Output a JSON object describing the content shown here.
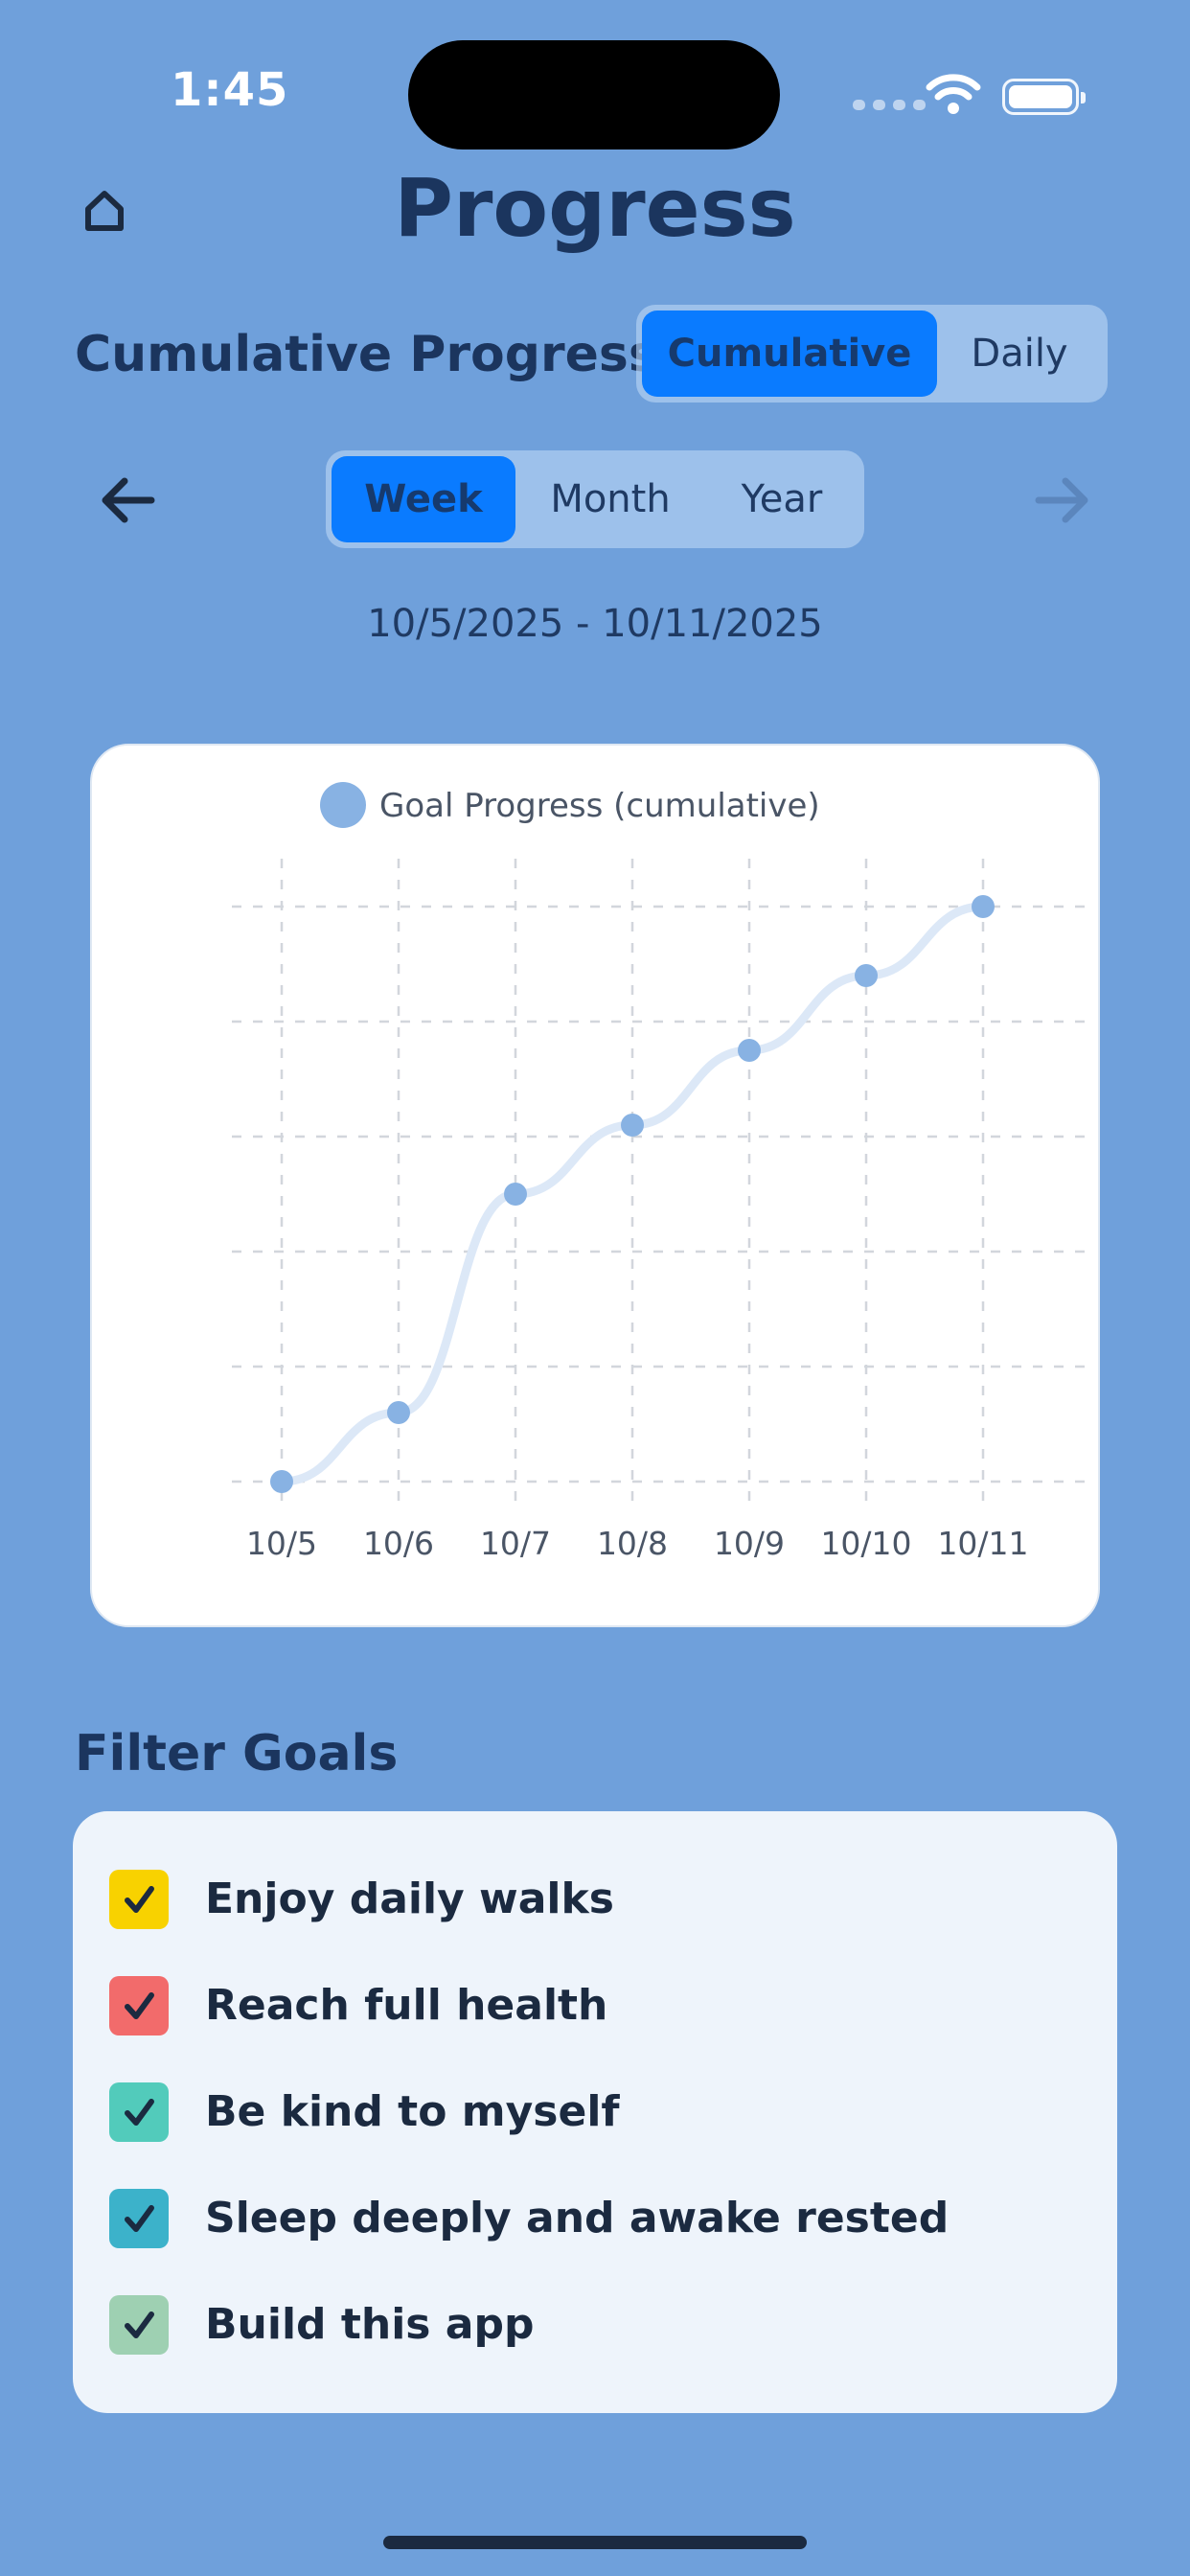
{
  "status": {
    "time": "1:45"
  },
  "header": {
    "title": "Progress",
    "home_icon": "home-icon"
  },
  "section": {
    "title": "Cumulative Progress"
  },
  "mode_toggle": {
    "options": [
      "Cumulative",
      "Daily"
    ],
    "selected": "Cumulative"
  },
  "range_toggle": {
    "options": [
      "Week",
      "Month",
      "Year"
    ],
    "selected": "Week"
  },
  "nav": {
    "prev_icon": "arrow-left-icon",
    "next_icon": "arrow-right-icon"
  },
  "date_range": "10/5/2025 - 10/11/2025",
  "colors": {
    "background": "#6fa0db",
    "accent": "#0a7bff",
    "series": "#88b2e3",
    "line": "#dce8f7"
  },
  "chart_data": {
    "type": "line",
    "legend": [
      "Goal Progress (cumulative)"
    ],
    "categories": [
      "10/5",
      "10/6",
      "10/7",
      "10/8",
      "10/9",
      "10/10",
      "10/11"
    ],
    "series": [
      {
        "name": "Goal Progress (cumulative)",
        "values": [
          0,
          0.6,
          2.5,
          3.1,
          3.75,
          4.4,
          5.0
        ]
      }
    ],
    "ylim": [
      0,
      5
    ],
    "grid": true,
    "legend_position": "top-center"
  },
  "filter": {
    "title": "Filter Goals",
    "goals": [
      {
        "label": "Enjoy daily walks",
        "color": "#f8d200",
        "checked": true
      },
      {
        "label": "Reach full health",
        "color": "#f26b6b",
        "checked": true
      },
      {
        "label": "Be kind to myself",
        "color": "#52cbbb",
        "checked": true
      },
      {
        "label": "Sleep deeply and awake rested",
        "color": "#3cb2ca",
        "checked": true
      },
      {
        "label": "Build this app",
        "color": "#9ed0b2",
        "checked": true
      }
    ]
  }
}
